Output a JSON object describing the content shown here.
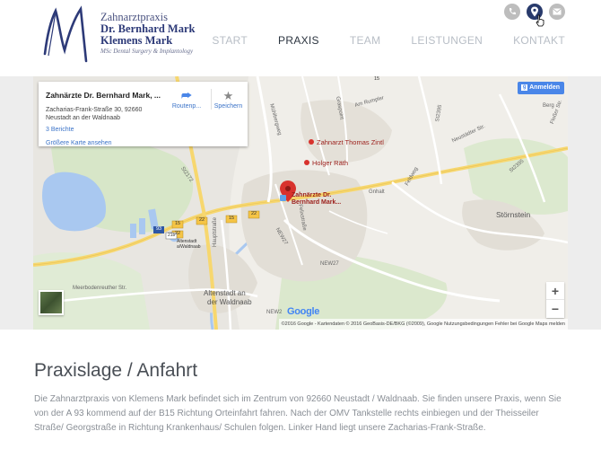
{
  "logo": {
    "line1": "Zahnarztpraxis",
    "line2": "Dr. Bernhard Mark",
    "line3": "Klemens Mark",
    "line4": "MSc Dental Surgery & Implantology"
  },
  "top_icons": [
    "phone-icon",
    "location-pin-icon",
    "mail-icon"
  ],
  "nav": {
    "items": [
      {
        "label": "START"
      },
      {
        "label": "PRAXIS"
      },
      {
        "label": "TEAM"
      },
      {
        "label": "LEISTUNGEN"
      },
      {
        "label": "KONTAKT"
      }
    ]
  },
  "map": {
    "infocard": {
      "title": "Zahnärzte Dr. Bernhard Mark, ...",
      "address_line1": "Zacharias-Frank-Straße 30, 92660",
      "address_line2": "Neustadt an der Waldnaab",
      "reviews": "3 Berichte",
      "bigger_map": "Größere Karte ansehen",
      "route_label": "Routenp...",
      "save_label": "Speichern"
    },
    "signin_label": "Anmelden",
    "zoom_in": "+",
    "zoom_out": "−",
    "marker_label_line1": "Zahnärzte Dr.",
    "marker_label_line2": "Bernhard Mark...",
    "poi_1": "Zahnarzt Thomas Zintl",
    "poi_2": "Holger Räth",
    "place_1": "Störnstein",
    "place_2": "Altenstadt an",
    "place_3": "der Waldnaab",
    "road_1": "Meerbodenreuther Str.",
    "road_2": "Hauptstraße",
    "road_3": "NEW27",
    "road_4": "NEW27",
    "road_5": "St2395",
    "road_6": "St2172",
    "road_7": "Neustädter Str.",
    "road_8": "St2395",
    "road_9": "Am Rumpler",
    "road_10": "Mühlbergweg",
    "road_11": "Feldweg",
    "road_12": "Gnhalt",
    "road_13": "Felixstraße",
    "road_14": "Graspoint",
    "road_15": "Floßer Str.",
    "road_16": "Berg",
    "road_17": "NEW2",
    "shield_1": "15",
    "shield_2": "22",
    "shield_3": "15",
    "shield_4": "22",
    "shield_5": "93",
    "shield_6": "21b",
    "shield_7": "22",
    "shield_8": "15",
    "exit_label_1": "Altenstadt",
    "exit_label_2": "a/Waldnaab",
    "google_logo": "Google",
    "attribution": "©2016 Google - Kartendaten © 2016 GeoBasis-DE/BKG (©2009), Google    Nutzungsbedingungen    Fehler bei Google Maps melden"
  },
  "content": {
    "heading": "Praxislage / Anfahrt",
    "paragraph": "Die Zahnarztpraxis von Klemens Mark befindet sich im Zentrum von 92660 Neustadt / Waldnaab. Sie finden unsere Praxis, wenn Sie von der A 93 kommend auf der B15 Richtung Orteinfahrt fahren. Nach der OMV Tankstelle rechts einbiegen und der Theisseiler Straße/ Georgstraße in Richtung Krankenhaus/ Schulen folgen. Linker Hand liegt unsere Zacharias-Frank-Straße."
  },
  "colors": {
    "brand_navy": "#283a6b",
    "nav_inactive": "#b8bec6",
    "nav_active": "#2c3540",
    "link_blue": "#3b73c8",
    "marker_red": "#d8322d"
  }
}
